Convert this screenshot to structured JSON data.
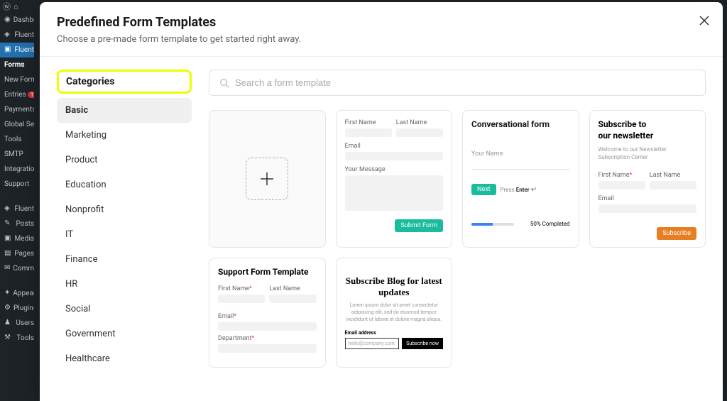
{
  "wp_menu": {
    "items": [
      {
        "label": "Dashboard",
        "icon": "dashboard"
      },
      {
        "label": "Fluent",
        "icon": "fluent"
      },
      {
        "label": "Fluent",
        "icon": "fluent",
        "active": true
      }
    ],
    "submenu": [
      {
        "label": "Forms",
        "current": true
      },
      {
        "label": "New Form"
      },
      {
        "label": "Entries",
        "badge": "1"
      },
      {
        "label": "Payments"
      },
      {
        "label": "Global Settings"
      },
      {
        "label": "Tools"
      },
      {
        "label": "SMTP"
      },
      {
        "label": "Integrations"
      },
      {
        "label": "Support"
      }
    ],
    "lower": [
      {
        "label": "Fluent"
      },
      {
        "label": "Posts"
      },
      {
        "label": "Media"
      },
      {
        "label": "Pages"
      },
      {
        "label": "Comments"
      },
      {
        "label": "Appearance"
      },
      {
        "label": "Plugins"
      },
      {
        "label": "Users"
      },
      {
        "label": "Tools"
      }
    ]
  },
  "modal": {
    "title": "Predefined Form Templates",
    "subtitle": "Choose a pre-made form template to get started right away."
  },
  "categories": {
    "title": "Categories",
    "items": [
      {
        "label": "Basic",
        "active": true
      },
      {
        "label": "Marketing"
      },
      {
        "label": "Product"
      },
      {
        "label": "Education"
      },
      {
        "label": "Nonprofit"
      },
      {
        "label": "IT"
      },
      {
        "label": "Finance"
      },
      {
        "label": "HR"
      },
      {
        "label": "Social"
      },
      {
        "label": "Government"
      },
      {
        "label": "Healthcare"
      }
    ]
  },
  "search": {
    "placeholder": "Search a form template"
  },
  "templates": {
    "contact": {
      "first_name": "First Name",
      "last_name": "Last Name",
      "email": "Email",
      "your_message": "Your Message",
      "submit": "Submit Form"
    },
    "conversational": {
      "title": "Conversational form",
      "your_name": "Your Name",
      "next": "Next",
      "press": "Press",
      "enter": "Enter",
      "completed": "50% Completed"
    },
    "newsletter": {
      "title_line1": "Subscribe to",
      "title_line2": "our newsletter",
      "subtitle": "Welcome to our Newsletter Subscription Center",
      "first_name": "First Name",
      "last_name": "Last Name",
      "email": "Email",
      "subscribe": "Subscribe"
    },
    "support": {
      "title": "Support Form Template",
      "first_name": "First Name",
      "last_name": "Last Name",
      "email": "Email",
      "department": "Department"
    },
    "blog": {
      "title": "Subscribe Blog for latest updates",
      "desc": "Lorem ipsum dolor sit amet consectetur adipiscing elit, sed do eiusmod tempor incididunt ut labore et dolore magna aliqua.",
      "email_label": "Email address",
      "placeholder": "hello@company.com",
      "button": "Subscribe now"
    }
  }
}
